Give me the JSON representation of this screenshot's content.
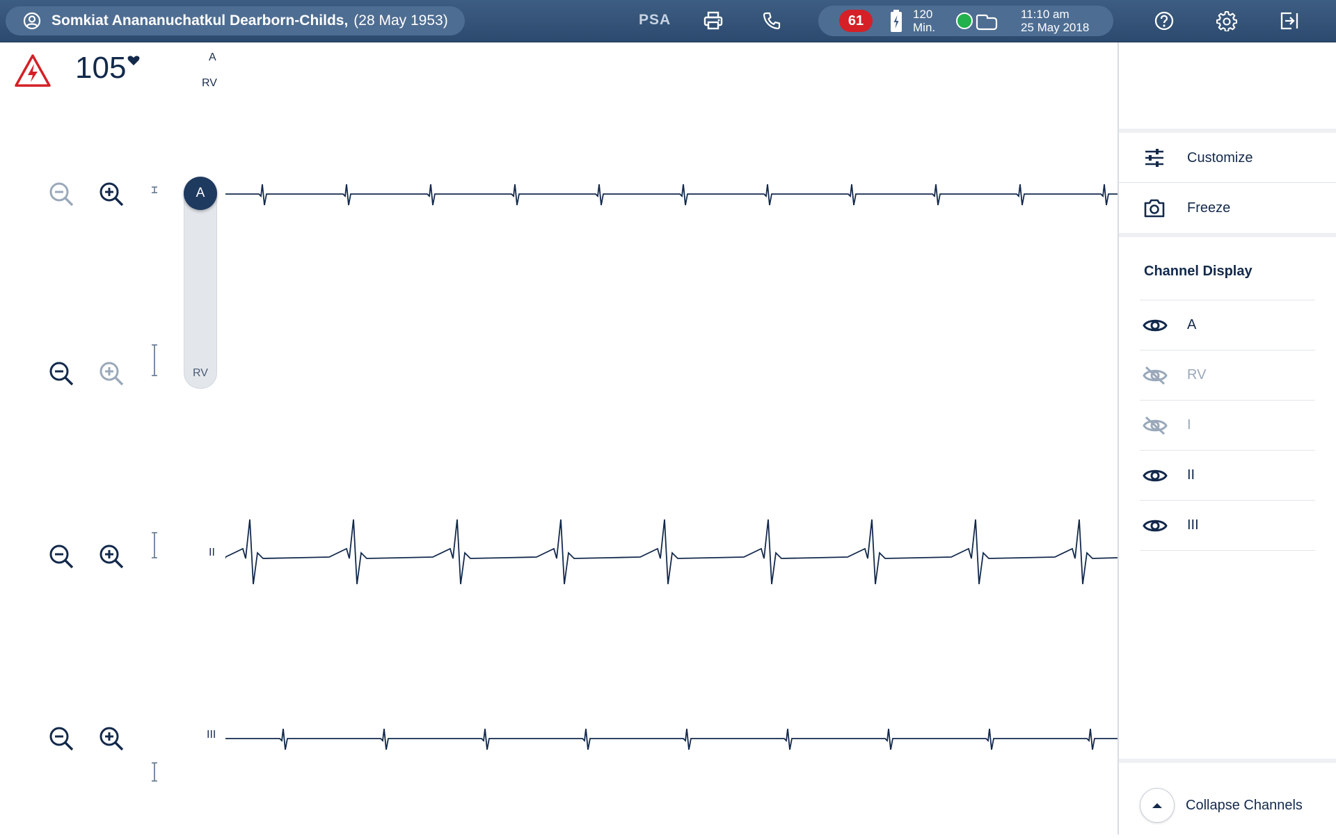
{
  "patient": {
    "name": "Somkiat Anananuchatkul Dearborn-Childs,",
    "dob": "(28 May 1953)"
  },
  "topbar": {
    "mode": "PSA",
    "icons": [
      "user-icon",
      "printer-icon",
      "phone-icon",
      "battery-icon",
      "pads-icon",
      "help-icon",
      "gear-icon",
      "exit-icon"
    ],
    "alarm_count": "61",
    "battery_value": "120",
    "battery_unit": "Min.",
    "time": "11:10 am",
    "date": "25 May 2018",
    "status_color": "#22b14c",
    "alarm_color": "#d42026"
  },
  "vitals": {
    "heart_rate": "105",
    "lead_top": "A",
    "lead_bottom": "RV"
  },
  "channels": [
    {
      "label": "",
      "visible": true
    },
    {
      "label": "",
      "visible": true
    },
    {
      "label": "II",
      "visible": true
    },
    {
      "label": "III",
      "visible": true
    }
  ],
  "lead_slider": {
    "knob_label": "A",
    "bottom_label": "RV"
  },
  "right_panel": {
    "customize_label": "Customize",
    "freeze_label": "Freeze",
    "channel_display_title": "Channel Display",
    "channel_display": [
      {
        "label": "A",
        "visible": true
      },
      {
        "label": "RV",
        "visible": false
      },
      {
        "label": "I",
        "visible": false
      },
      {
        "label": "II",
        "visible": true
      },
      {
        "label": "III",
        "visible": true
      }
    ],
    "collapse_label": "Collapse Channels"
  },
  "colors": {
    "topbar": "#2c4a6e",
    "navy": "#13294b",
    "waveform": "#13294b",
    "muted": "#9aa8ba"
  }
}
